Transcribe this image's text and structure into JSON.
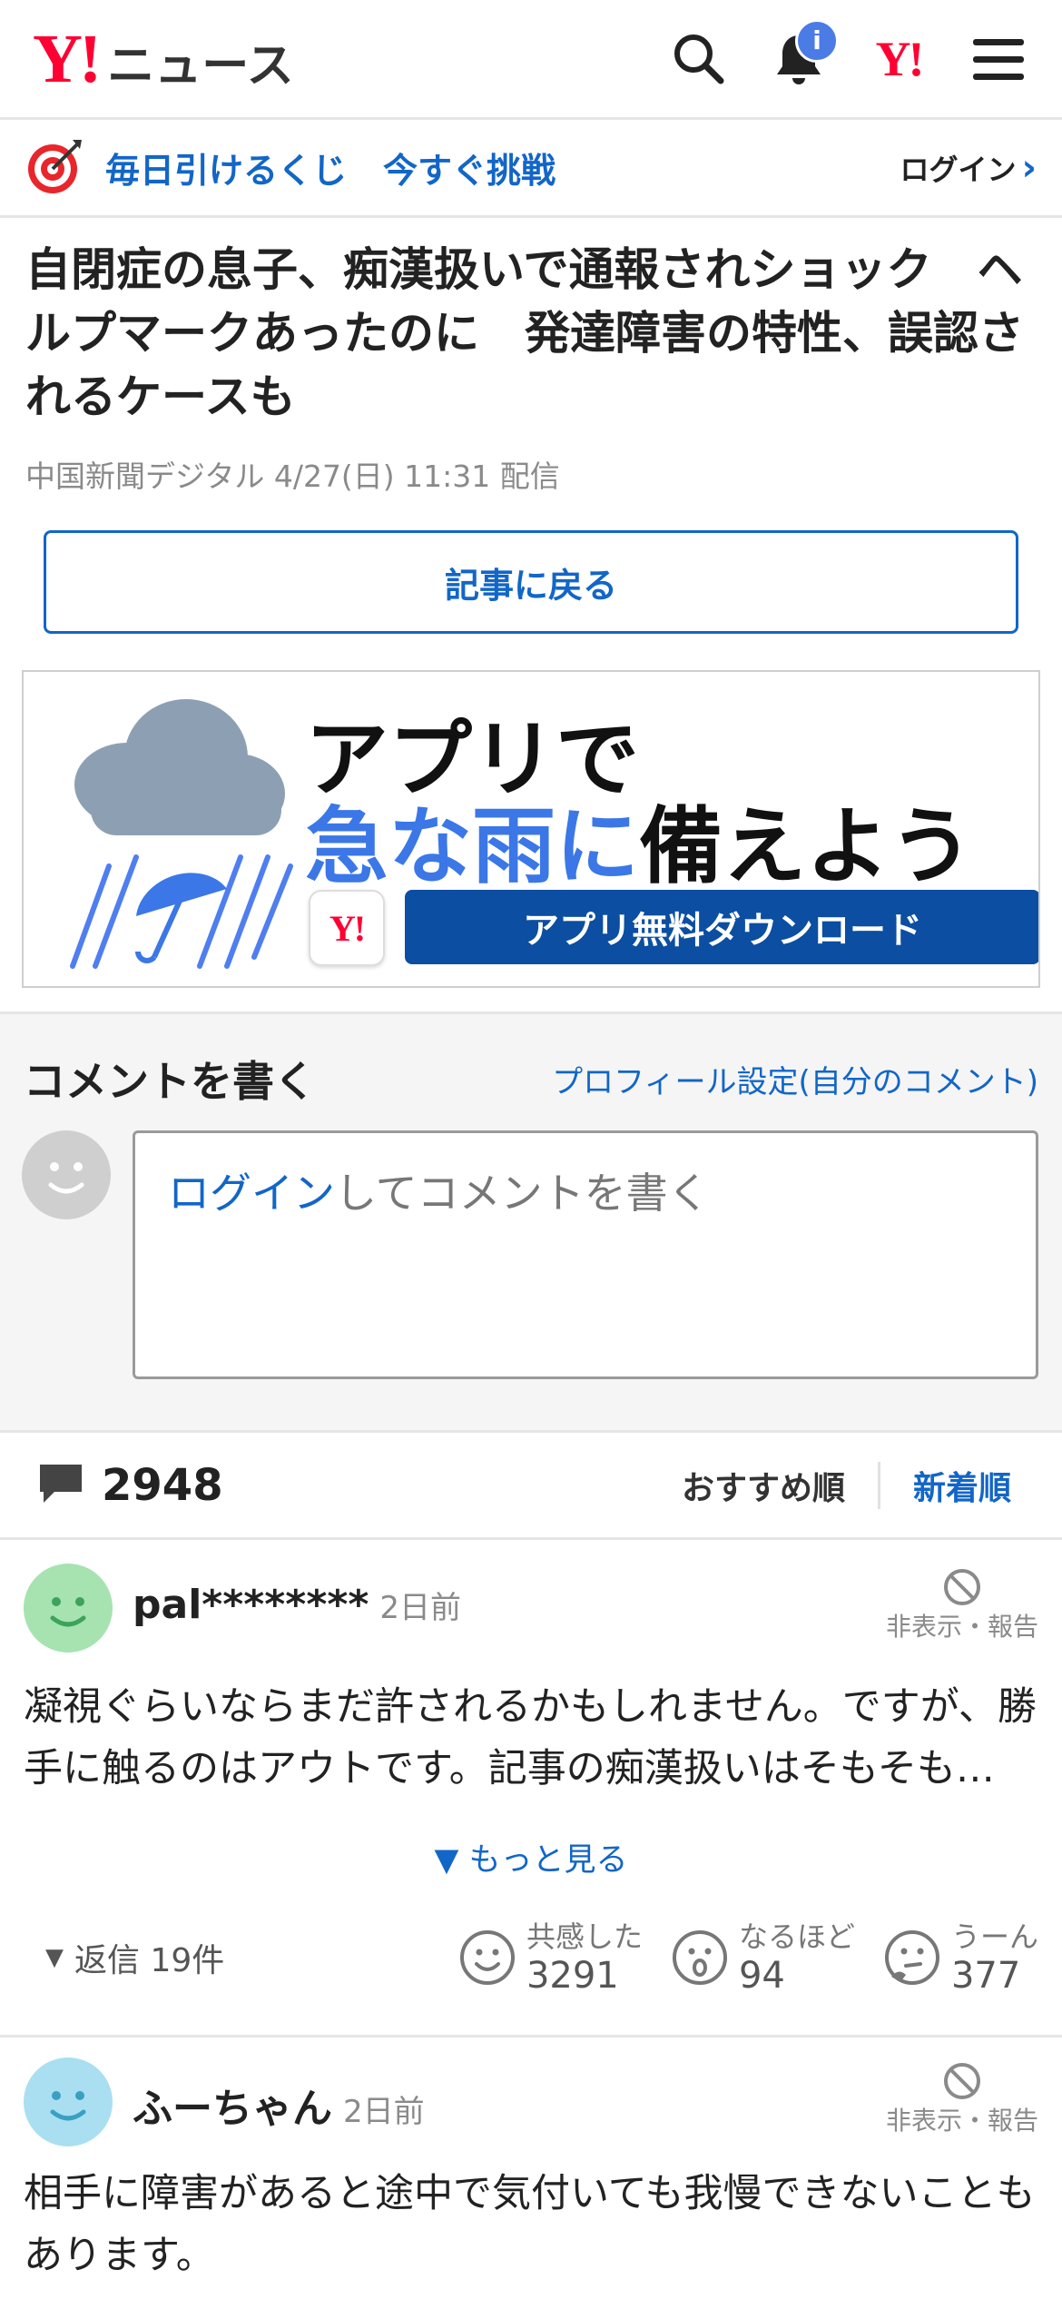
{
  "header": {
    "logo_y": "Y!",
    "logo_text": "ニュース",
    "notification_badge": "i",
    "yahoo_mark": "Y!"
  },
  "promo": {
    "text_1": "毎日引けるくじ",
    "text_2": "今すぐ挑戦",
    "login": "ログイン"
  },
  "article": {
    "title": "自閉症の息子、痴漢扱いで通報されショック　ヘルプマークあったのに　発達障害の特性、誤認されるケースも",
    "meta": "中国新聞デジタル 4/27(日) 11:31 配信",
    "back_button": "記事に戻る"
  },
  "ad": {
    "line1": "アプリで",
    "line2_blue": "急な雨に",
    "line2_black": "備えよう",
    "app_logo": "Y!",
    "cta": "アプリ無料ダウンロード"
  },
  "composer": {
    "title": "コメントを書く",
    "profile_link": "プロフィール設定(自分のコメント)",
    "login_word": "ログイン",
    "placeholder_rest": "してコメントを書く"
  },
  "comments_bar": {
    "count": "2948",
    "sort_recommended": "おすすめ順",
    "sort_newest": "新着順"
  },
  "comments": [
    {
      "user": "pal********",
      "time": "2日前",
      "hide_report": "非表示・報告",
      "body": "凝視ぐらいならまだ許されるかもしれません。ですが、勝手に触るのはアウトです。記事の痴漢扱いはそもそも…",
      "more": "もっと見る",
      "replies": "返信 19件",
      "reactions": [
        {
          "label": "共感した",
          "count": "3291"
        },
        {
          "label": "なるほど",
          "count": "94"
        },
        {
          "label": "うーん",
          "count": "377"
        }
      ]
    },
    {
      "user": "ふーちゃん",
      "time": "2日前",
      "hide_report": "非表示・報告",
      "body": "相手に障害があると途中で気付いても我慢できないこともあります。"
    }
  ],
  "colors": {
    "brand_red": "#ff0033",
    "link_blue": "#1266c7",
    "ad_blue": "#0b4ea2",
    "avatar_green": "#a6e3b1",
    "avatar_blue": "#a9dff0"
  }
}
